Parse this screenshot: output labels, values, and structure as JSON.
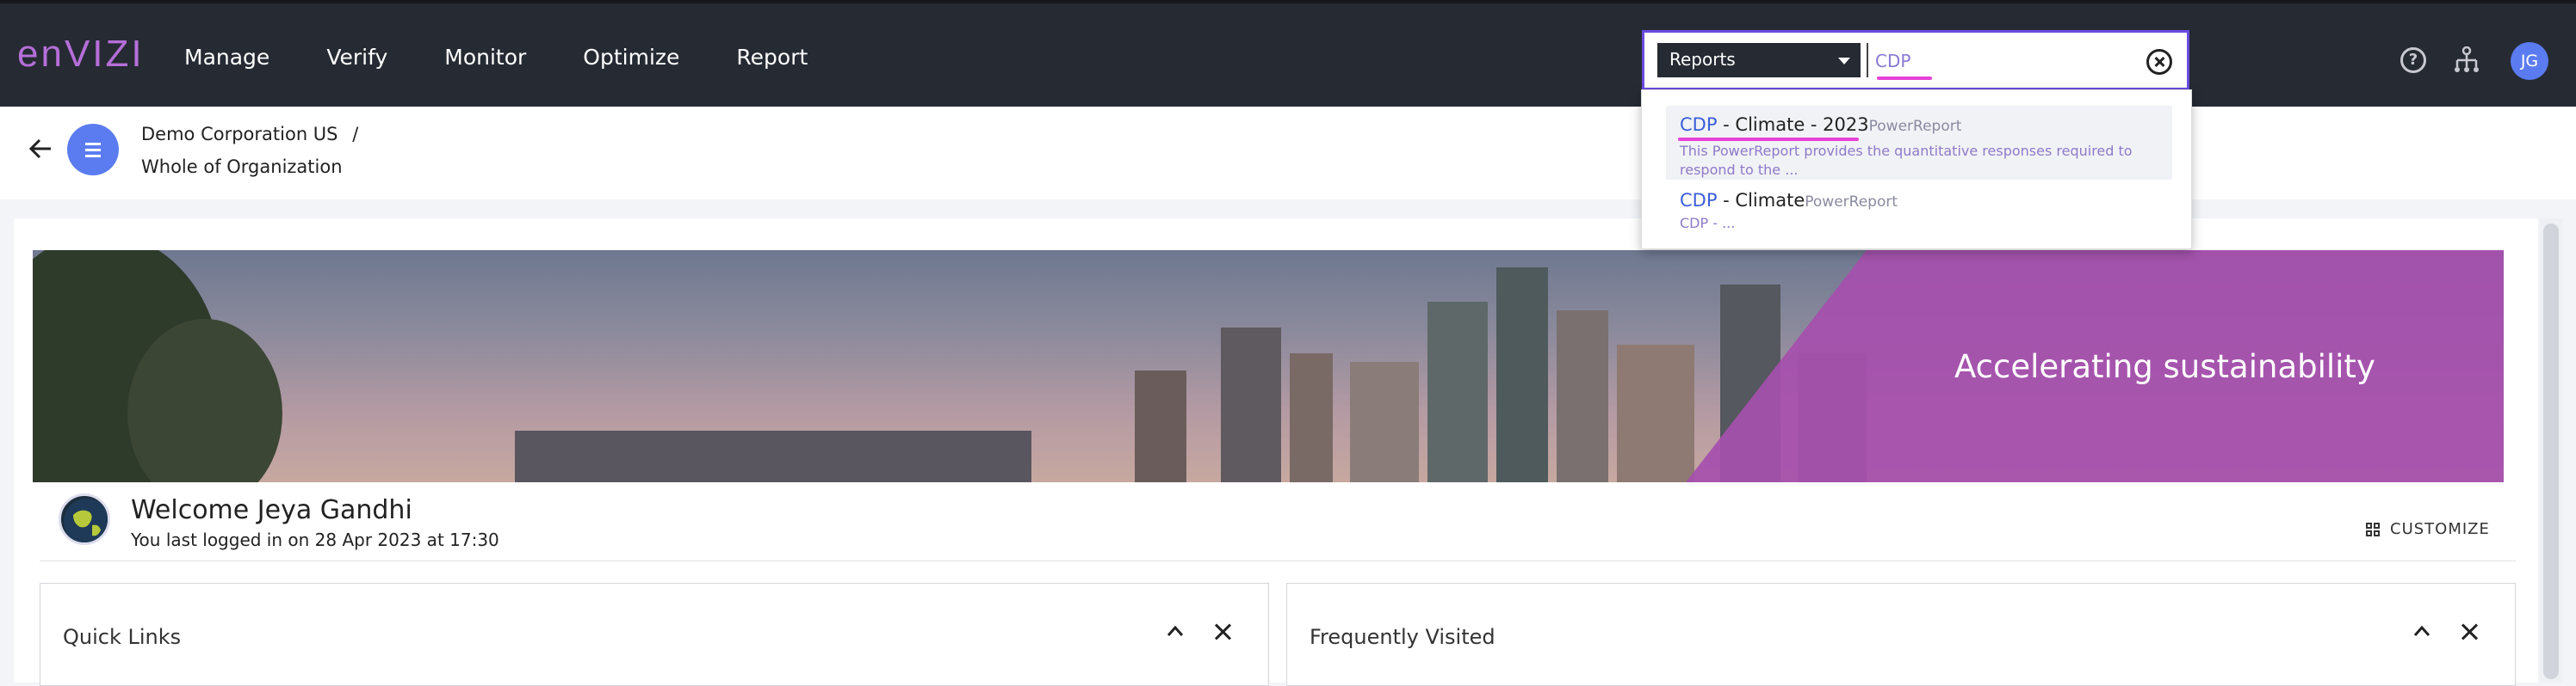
{
  "app": {
    "logo": "enVIZI"
  },
  "nav": {
    "items": [
      "Manage",
      "Verify",
      "Monitor",
      "Optimize",
      "Report"
    ]
  },
  "search": {
    "scope": "Reports",
    "value": "CDP",
    "results": [
      {
        "match": "CDP",
        "rest": " - Climate - 2023",
        "type": "PowerReport",
        "desc": "This PowerReport provides the quantitative responses required to respond to the ..."
      },
      {
        "match": "CDP",
        "rest": " - Climate",
        "type": "PowerReport",
        "desc": "CDP - ..."
      }
    ]
  },
  "user": {
    "initials": "JG"
  },
  "breadcrumb": {
    "org": "Demo Corporation US",
    "sep": "/",
    "level": "Whole of Organization"
  },
  "banner": {
    "title": "Accelerating sustainability"
  },
  "welcome": {
    "title": "Welcome Jeya Gandhi",
    "last_login": "You last logged in on 28 Apr 2023 at 17:30"
  },
  "customize": {
    "label": "CUSTOMIZE"
  },
  "widgets": [
    {
      "title": "Quick Links"
    },
    {
      "title": "Frequently Visited"
    }
  ],
  "colors": {
    "topbar": "#262a33",
    "accent": "#5b7cf0",
    "brand": "#b46fd8",
    "banner_overlay": "#a64fae",
    "highlight": "#e641d8"
  }
}
